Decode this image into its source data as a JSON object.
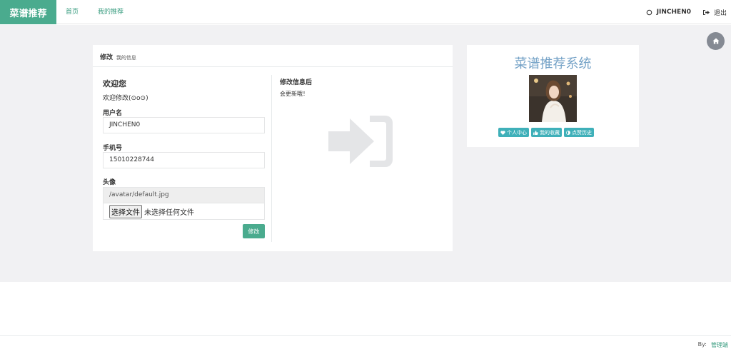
{
  "navbar": {
    "brand": "菜谱推荐",
    "links": [
      {
        "label": "首页"
      },
      {
        "label": "我的推荐"
      }
    ],
    "user": "JINCHEN0",
    "logout": "退出"
  },
  "panel": {
    "title": "修改",
    "subtitle": "我的信息",
    "welcome": "欢迎您",
    "welcome_sub": "欢迎修改(⊙o⊙)",
    "form": {
      "username_label": "用户名",
      "username_value": "JINCHEN0",
      "phone_label": "手机号",
      "phone_value": "15010228744",
      "avatar_label": "头像",
      "avatar_value": "/avatar/default.jpg",
      "file_button": "选择文件",
      "file_status": "未选择任何文件",
      "submit": "修改"
    },
    "right": {
      "title": "修改信息后",
      "subtitle": "会更新哦！"
    }
  },
  "card": {
    "title": "菜谱推荐系统",
    "buttons": [
      {
        "label": "个人中心",
        "icon": "heart-icon"
      },
      {
        "label": "我的收藏",
        "icon": "thumbs-up-icon"
      },
      {
        "label": "点赞历史",
        "icon": "adjust-icon"
      }
    ]
  },
  "footer": {
    "by": "By:",
    "link": "管理端"
  },
  "colors": {
    "brand": "#4aab8e",
    "card_title": "#73a1c6",
    "card_button": "#3fb0b9",
    "band": "#f1f1f3"
  }
}
